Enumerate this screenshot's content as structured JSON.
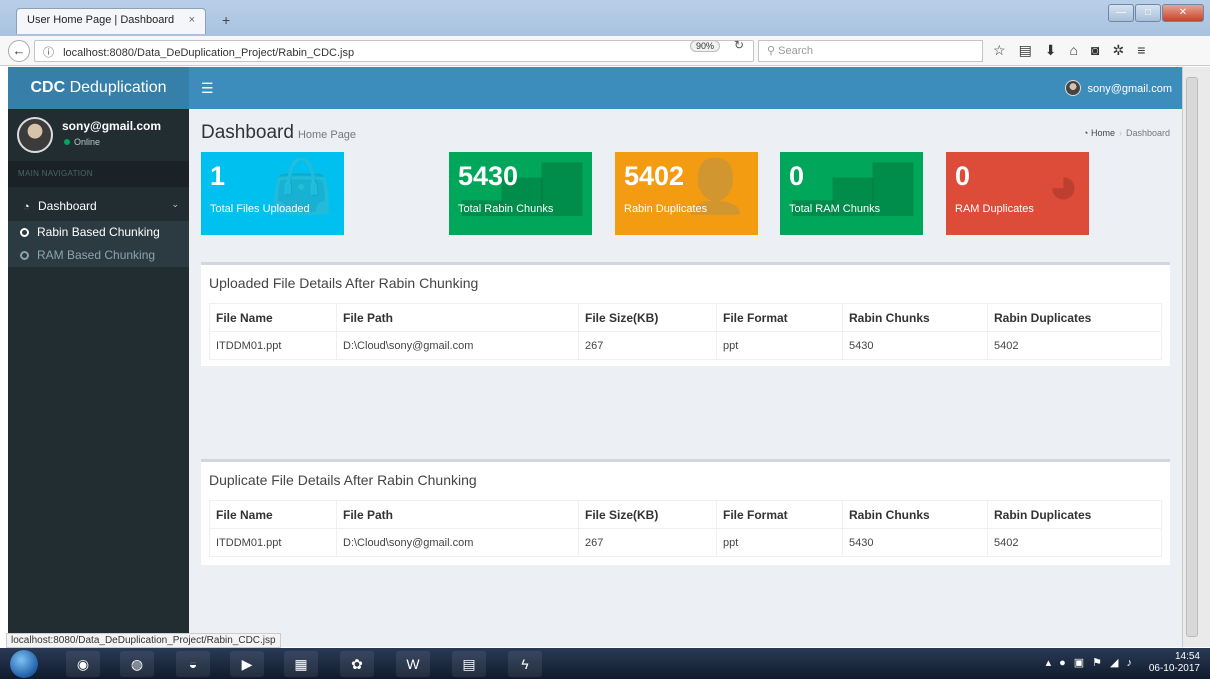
{
  "browser": {
    "tab_title": "User Home Page | Dashboard",
    "tab_close": "×",
    "new_tab": "+",
    "url": "localhost:8080/Data_DeDuplication_Project/Rabin_CDC.jsp",
    "zoom": "90%",
    "search_placeholder": "Search",
    "status_url": "localhost:8080/Data_DeDuplication_Project/Rabin_CDC.jsp"
  },
  "app": {
    "brand": "CDC",
    "brand_rest": " Deduplication",
    "user_email": "sony@gmail.com",
    "user_status": "Online",
    "nav_header": "MAIN NAVIGATION",
    "menu": {
      "dashboard": "Dashboard",
      "sub": [
        "Rabin Based Chunking",
        "RAM Based Chunking"
      ]
    },
    "topbar_user": "sony@gmail.com"
  },
  "page": {
    "title": "Dashboard",
    "subtitle": "Home Page",
    "breadcrumb": {
      "home": "Home",
      "current": "Dashboard"
    }
  },
  "stats": [
    {
      "value": "1",
      "label": "Total Files Uploaded",
      "color": "#00c0ef",
      "icon": "shopping-bag-icon"
    },
    {
      "value": "5430",
      "label": "Total Rabin Chunks",
      "color": "#00a65a",
      "icon": "bar-chart-icon"
    },
    {
      "value": "5402",
      "label": "Rabin Duplicates",
      "color": "#f39c12",
      "icon": "user-add-icon"
    },
    {
      "value": "0",
      "label": "Total RAM Chunks",
      "color": "#00a65a",
      "icon": "bar-chart-icon"
    },
    {
      "value": "0",
      "label": "RAM Duplicates",
      "color": "#dd4b39",
      "icon": "pie-chart-icon"
    }
  ],
  "table_headers": [
    "File Name",
    "File Path",
    "File Size(KB)",
    "File Format",
    "Rabin Chunks",
    "Rabin Duplicates"
  ],
  "uploaded": {
    "title": "Uploaded File Details After Rabin Chunking",
    "rows": [
      [
        "ITDDM01.ppt",
        "D:\\Cloud\\sony@gmail.com",
        "267",
        "ppt",
        "5430",
        "5402"
      ]
    ]
  },
  "duplicate": {
    "title": "Duplicate File Details After Rabin Chunking",
    "rows": [
      [
        "ITDDM01.ppt",
        "D:\\Cloud\\sony@gmail.com",
        "267",
        "ppt",
        "5430",
        "5402"
      ]
    ]
  },
  "taskbar": {
    "time": "14:54",
    "date": "06-10-2017"
  }
}
